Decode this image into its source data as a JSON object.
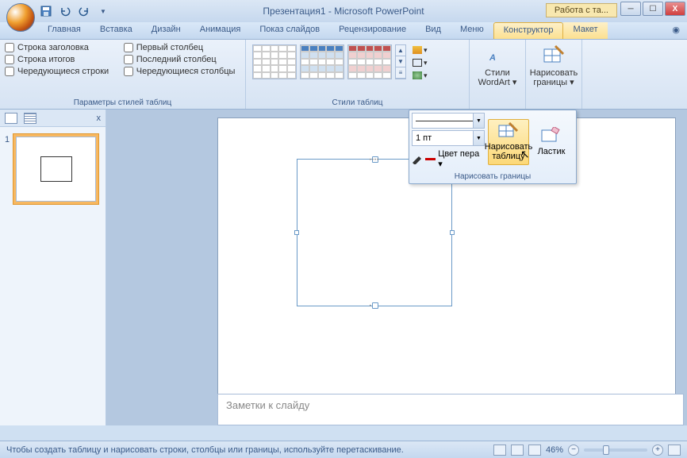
{
  "title": "Презентация1 - Microsoft PowerPoint",
  "context_tab": "Работа с та...",
  "tabs": [
    "Главная",
    "Вставка",
    "Дизайн",
    "Анимация",
    "Показ слайдов",
    "Рецензирование",
    "Вид",
    "Меню",
    "Конструктор",
    "Макет"
  ],
  "active_tab": "Конструктор",
  "ribbon": {
    "group1": {
      "label": "Параметры стилей таблиц",
      "checks": [
        "Строка заголовка",
        "Первый столбец",
        "Строка итогов",
        "Последний столбец",
        "Чередующиеся строки",
        "Чередующиеся столбцы"
      ]
    },
    "group2": {
      "label": "Стили таблиц"
    },
    "wordart": {
      "label": "Стили",
      "sub": "WordArt ▾"
    },
    "draw": {
      "label": "Нарисовать",
      "sub": "границы ▾"
    }
  },
  "draw_panel": {
    "weight": "1 пт",
    "pen": "Цвет пера ▾",
    "btn1": "Нарисовать таблицу",
    "btn2": "Ластик",
    "footer": "Нарисовать границы"
  },
  "notes": "Заметки к слайду",
  "status": "Чтобы создать таблицу и нарисовать строки, столбцы или границы, используйте перетаскивание.",
  "zoom": "46%"
}
